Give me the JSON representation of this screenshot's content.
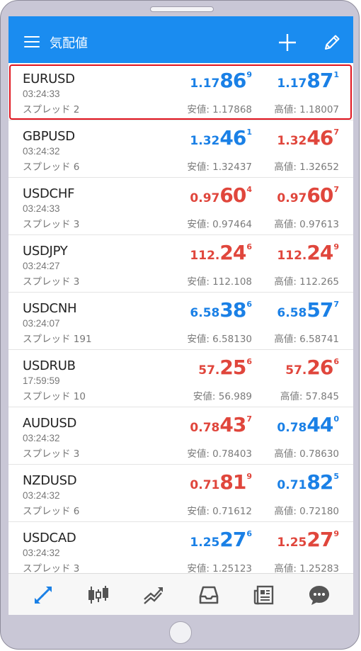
{
  "appbar": {
    "title": "気配値",
    "icons": [
      "menu-icon",
      "plus-icon",
      "pencil-icon"
    ]
  },
  "colors": {
    "appbar": "#1a8cf0",
    "up": "#1a80e6",
    "down": "#e0463c",
    "highlight": "#e0141e"
  },
  "quotes": [
    {
      "symbol": "EURUSD",
      "time": "03:24:33",
      "spread": "スプレッド 2",
      "bid": {
        "small": "1.17",
        "big": "86",
        "sup": "9",
        "color": "blue"
      },
      "ask": {
        "small": "1.17",
        "big": "87",
        "sup": "1",
        "color": "blue"
      },
      "low": "安値: 1.17868",
      "high": "高値: 1.18007",
      "highlighted": true
    },
    {
      "symbol": "GBPUSD",
      "time": "03:24:32",
      "spread": "スプレッド 6",
      "bid": {
        "small": "1.32",
        "big": "46",
        "sup": "1",
        "color": "blue"
      },
      "ask": {
        "small": "1.32",
        "big": "46",
        "sup": "7",
        "color": "red"
      },
      "low": "安値: 1.32437",
      "high": "高値: 1.32652"
    },
    {
      "symbol": "USDCHF",
      "time": "03:24:33",
      "spread": "スプレッド 3",
      "bid": {
        "small": "0.97",
        "big": "60",
        "sup": "4",
        "color": "red"
      },
      "ask": {
        "small": "0.97",
        "big": "60",
        "sup": "7",
        "color": "red"
      },
      "low": "安値: 0.97464",
      "high": "高値: 0.97613"
    },
    {
      "symbol": "USDJPY",
      "time": "03:24:27",
      "spread": "スプレッド 3",
      "bid": {
        "small": "112.",
        "big": "24",
        "sup": "6",
        "color": "red"
      },
      "ask": {
        "small": "112.",
        "big": "24",
        "sup": "9",
        "color": "red"
      },
      "low": "安値: 112.108",
      "high": "高値: 112.265"
    },
    {
      "symbol": "USDCNH",
      "time": "03:24:07",
      "spread": "スプレッド 191",
      "bid": {
        "small": "6.58",
        "big": "38",
        "sup": "6",
        "color": "blue"
      },
      "ask": {
        "small": "6.58",
        "big": "57",
        "sup": "7",
        "color": "blue"
      },
      "low": "安値: 6.58130",
      "high": "高値: 6.58741"
    },
    {
      "symbol": "USDRUB",
      "time": "17:59:59",
      "spread": "スプレッド 10",
      "bid": {
        "small": "57.",
        "big": "25",
        "sup": "6",
        "color": "red"
      },
      "ask": {
        "small": "57.",
        "big": "26",
        "sup": "6",
        "color": "red"
      },
      "low": "安値: 56.989",
      "high": "高値: 57.845"
    },
    {
      "symbol": "AUDUSD",
      "time": "03:24:32",
      "spread": "スプレッド 3",
      "bid": {
        "small": "0.78",
        "big": "43",
        "sup": "7",
        "color": "red"
      },
      "ask": {
        "small": "0.78",
        "big": "44",
        "sup": "0",
        "color": "blue"
      },
      "low": "安値: 0.78403",
      "high": "高値: 0.78630"
    },
    {
      "symbol": "NZDUSD",
      "time": "03:24:32",
      "spread": "スプレッド 6",
      "bid": {
        "small": "0.71",
        "big": "81",
        "sup": "9",
        "color": "red"
      },
      "ask": {
        "small": "0.71",
        "big": "82",
        "sup": "5",
        "color": "blue"
      },
      "low": "安値: 0.71612",
      "high": "高値: 0.72180"
    },
    {
      "symbol": "USDCAD",
      "time": "03:24:32",
      "spread": "スプレッド 3",
      "bid": {
        "small": "1.25",
        "big": "27",
        "sup": "6",
        "color": "blue"
      },
      "ask": {
        "small": "1.25",
        "big": "27",
        "sup": "9",
        "color": "red"
      },
      "low": "安値: 1.25123",
      "high": "高値: 1.25283"
    }
  ],
  "tabs": [
    {
      "icon": "quotes-arrows-icon",
      "active": true
    },
    {
      "icon": "candlestick-chart-icon"
    },
    {
      "icon": "trade-icon"
    },
    {
      "icon": "history-inbox-icon"
    },
    {
      "icon": "news-icon"
    },
    {
      "icon": "chat-icon"
    }
  ]
}
